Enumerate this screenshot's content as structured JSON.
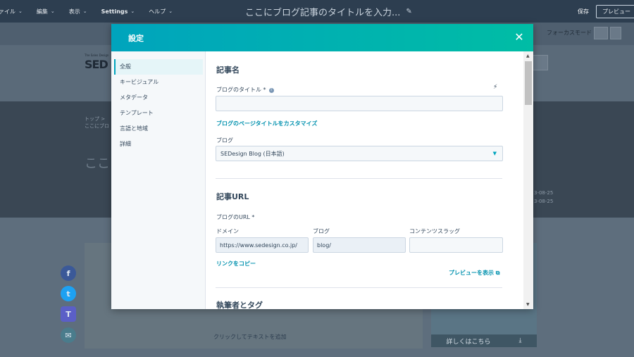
{
  "topbar": {
    "menus": [
      {
        "label": "ァイル"
      },
      {
        "label": "編集"
      },
      {
        "label": "表示"
      },
      {
        "label": "Settings"
      },
      {
        "label": "ヘルプ"
      }
    ],
    "doc_title": "ここにブログ記事のタイトルを入力...",
    "save_label": "保存",
    "preview_label": "プレビュー"
  },
  "background": {
    "focus_mode": "フォーカスモード",
    "logo": "SED",
    "crumb_line1": "トップ > ",
    "crumb_line2": "ここにブロ",
    "hero_title": "ここ",
    "date1": "3-08-25",
    "date2": "3-08-25",
    "add_text": "クリックしてテキストを追加",
    "banner_link": "詳しくはこちら"
  },
  "modal": {
    "title": "設定",
    "nav": [
      {
        "label": "全般",
        "active": true
      },
      {
        "label": "キービジュアル"
      },
      {
        "label": "メタデータ"
      },
      {
        "label": "テンプレート"
      },
      {
        "label": "言語と地域"
      },
      {
        "label": "詳細"
      }
    ],
    "section_post_name": "記事名",
    "blog_title_label": "ブログのタイトル *",
    "blog_title_value": "",
    "customize_link": "ブログのページタイトルをカスタマイズ",
    "blog_label": "ブログ",
    "blog_selected": "SEDesign Blog (日本語)",
    "section_url": "記事URL",
    "blog_url_label": "ブログのURL *",
    "domain_label": "ドメイン",
    "blog_col_label": "ブログ",
    "slug_label": "コンテンツスラッグ",
    "domain_value": "https://www.sedesign.co.jp/",
    "blog_path_value": "blog/",
    "slug_value": "",
    "copy_link": "リンクをコピー",
    "preview_link": "プレビューを表示",
    "section_author": "執筆者とタグ"
  },
  "colors": {
    "header_start": "#00a4bd",
    "header_end": "#00bda5",
    "link": "#0091ae",
    "topbar": "#2d3e50"
  }
}
